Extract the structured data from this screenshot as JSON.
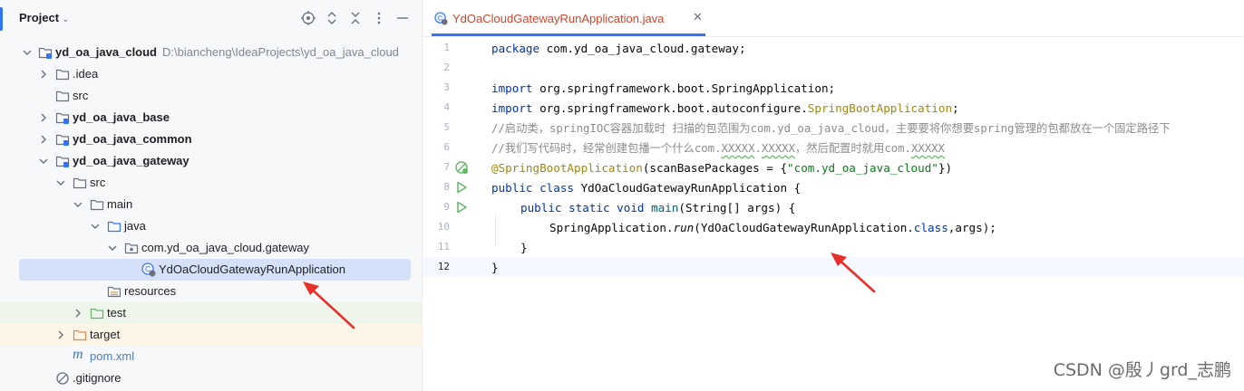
{
  "project_panel": {
    "title": "Project",
    "tree": [
      {
        "label": "yd_oa_java_cloud",
        "path": "D:\\biancheng\\IdeaProjects\\yd_oa_java_cloud"
      },
      {
        "label": ".idea"
      },
      {
        "label": "src"
      },
      {
        "label": "yd_oa_java_base"
      },
      {
        "label": "yd_oa_java_common"
      },
      {
        "label": "yd_oa_java_gateway"
      },
      {
        "label": "src"
      },
      {
        "label": "main"
      },
      {
        "label": "java"
      },
      {
        "label": "com.yd_oa_java_cloud.gateway"
      },
      {
        "label": "YdOaCloudGatewayRunApplication"
      },
      {
        "label": "resources"
      },
      {
        "label": "test"
      },
      {
        "label": "target"
      },
      {
        "label": "pom.xml"
      },
      {
        "label": ".gitignore"
      }
    ]
  },
  "editor": {
    "tab_label": "YdOaCloudGatewayRunApplication.java",
    "line_numbers": [
      "1",
      "2",
      "3",
      "4",
      "5",
      "6",
      "7",
      "8",
      "9",
      "10",
      "11",
      "12"
    ],
    "code": {
      "l1_kw": "package",
      "l1_rest": " com.yd_oa_java_cloud.gateway;",
      "l3_kw": "import",
      "l3_rest": " org.springframework.boot.SpringApplication;",
      "l4_kw": "import",
      "l4_rest": " org.springframework.boot.autoconfigure.",
      "l4_ann": "SpringBootApplication",
      "l4_end": ";",
      "l5": "//启动类，springIOC容器加载时 扫描的包范围为com.yd_oa_java_cloud，主要要将你想要spring管理的包都放在一个固定路径下",
      "l6_a": "//我们写代码时，经常创建包播一个什么com.",
      "l6_b": "XXXXX",
      "l6_c": ".",
      "l6_d": "XXXXX",
      "l6_e": "，然后配置时就用com.",
      "l6_f": "XXXXX",
      "l7_ann": "@SpringBootApplication",
      "l7_mid": "(scanBasePackages = {",
      "l7_str": "\"com.yd_oa_java_cloud\"",
      "l7_end": "})",
      "l8_kw": "public class",
      "l8_rest": " YdOaCloudGatewayRunApplication {",
      "l9_kw": "public static void",
      "l9_m": "main",
      "l9_rest": "(String[] args) {",
      "l10_a": "SpringApplication.",
      "l10_m": "run",
      "l10_b": "(YdOaCloudGatewayRunApplication.",
      "l10_kw": "class",
      "l10_c": ",args);",
      "l11": "}",
      "l12": "}"
    }
  },
  "watermark": "CSDN @殷丿grd_志鹏",
  "colors": {
    "accent": "#3574f0",
    "annotation_arrow": "#e8302a",
    "tab_text": "#c9462f"
  }
}
